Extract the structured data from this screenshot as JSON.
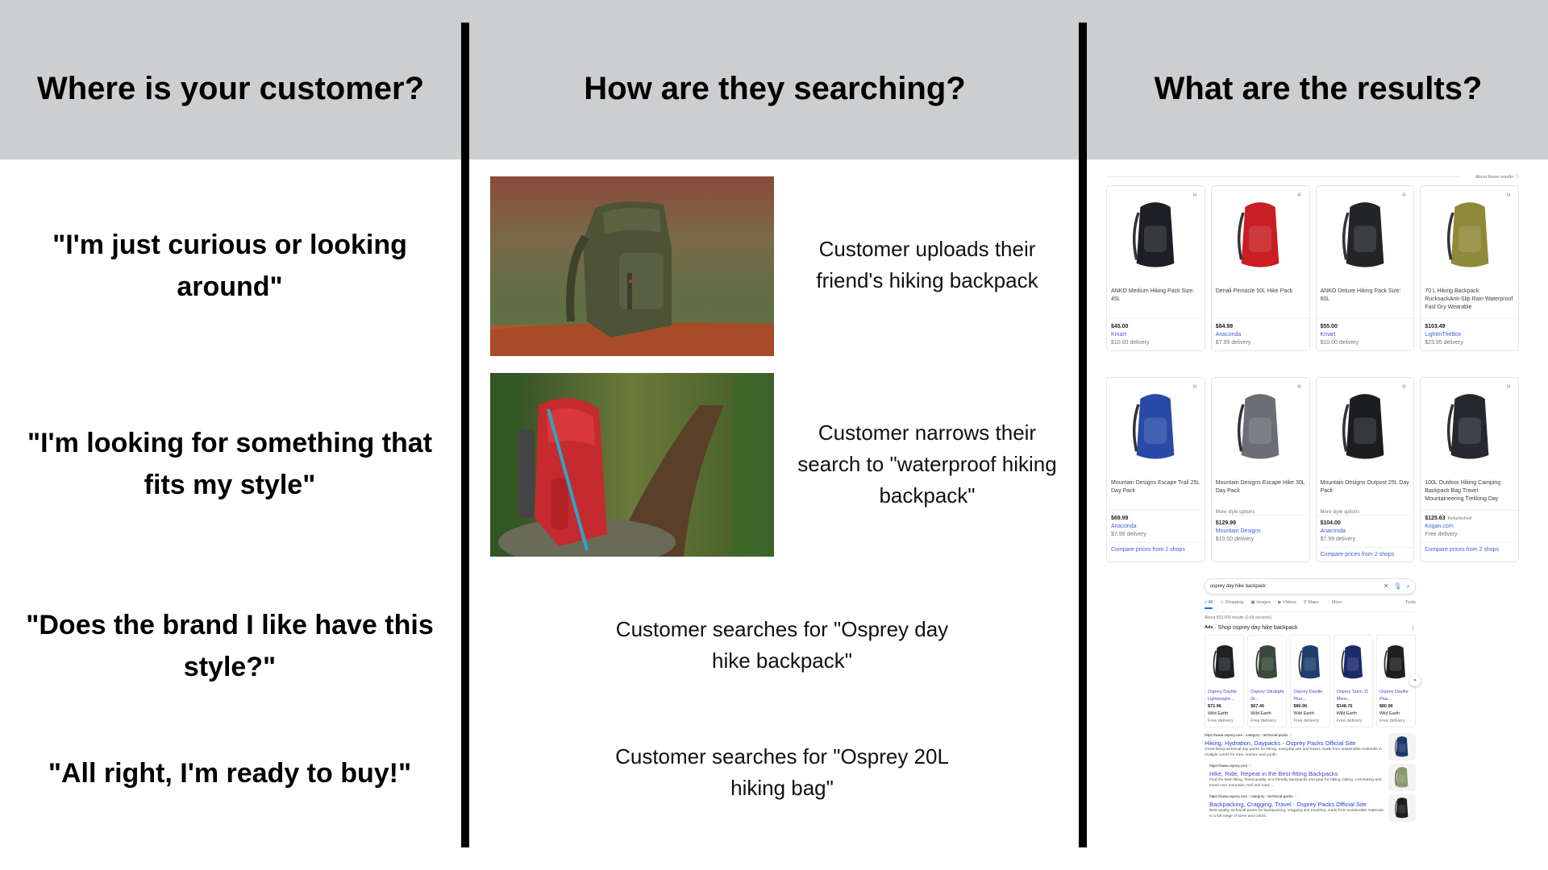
{
  "columns": [
    {
      "title": "Where is your customer?"
    },
    {
      "title": "How are they searching?"
    },
    {
      "title": "What are the results?"
    }
  ],
  "quotes": [
    "\"I'm just curious or looking around\"",
    "\"I'm looking for something that fits my style\"",
    "\"Does the brand I like have this style?\"",
    "\"All right, I'm ready to buy!\""
  ],
  "search_steps": [
    {
      "text": "Customer uploads their friend's hiking backpack",
      "image": "olive-backpack-on-red-rock-photo"
    },
    {
      "text": "Customer narrows their search to \"waterproof hiking backpack\"",
      "image": "red-backpack-in-forest-photo"
    },
    {
      "text": "Customer searches for \"Osprey day hike backpack\""
    },
    {
      "text": "Customer searches for \"Osprey 20L hiking bag\""
    }
  ],
  "results": {
    "about_label": "About these results ⓘ",
    "grid_row_1": [
      {
        "title": "ANKO Medium Hiking Pack Size: 45L",
        "price": "$45.00",
        "store": "Kmart",
        "delivery": "$10.00 delivery",
        "color": "#1d1f24"
      },
      {
        "title": "Denali Pinnacle 50L Hike Pack",
        "price": "$84.99",
        "store": "Anaconda",
        "delivery": "$7.99 delivery",
        "color": "#c81e24"
      },
      {
        "title": "ANKO Deluxe Hiking Pack Size: 60L",
        "price": "$55.00",
        "store": "Kmart",
        "delivery": "$10.00 delivery",
        "color": "#222428"
      },
      {
        "title": "70 L Hiking Backpack RucksackAnti-Slip Rain Waterproof Fast Dry Wearable",
        "price": "$103.49",
        "store": "LightInTheBox",
        "delivery": "$23.95 delivery",
        "color": "#8f8a3a"
      }
    ],
    "grid_row_2": [
      {
        "title": "Mountain Designs Escape Trail 25L Day Pack",
        "sub": "",
        "price": "$69.99",
        "store": "Anaconda",
        "delivery": "$7.99 delivery",
        "compare": "Compare prices from 2 shops",
        "color": "#2a4aa8"
      },
      {
        "title": "Mountain Designs Escape Hike 30L Day Pack",
        "sub": "More style options",
        "price": "$129.99",
        "store": "Mountain Designs",
        "delivery": "$10.00 delivery",
        "compare": "",
        "color": "#6b6e74"
      },
      {
        "title": "Mountain Designs Outpost 25L Day Pack",
        "sub": "More style options",
        "price": "$104.00",
        "store": "Anaconda",
        "delivery": "$7.99 delivery",
        "compare": "Compare prices from 2 shops",
        "color": "#1c1d20"
      },
      {
        "title": "100L Outdoor Hiking Camping Backpack Bag Travel Mountaineering Trekking Day",
        "sub": "",
        "price": "$125.63",
        "price_note": "Refurbished",
        "store": "Kogan.com",
        "delivery": "Free delivery",
        "compare": "Compare prices from 2 shops",
        "color": "#26282e"
      }
    ],
    "serp": {
      "query": "osprey day hike backpack",
      "tabs": [
        "All",
        "Shopping",
        "Images",
        "Videos",
        "Maps",
        "More"
      ],
      "tools_label": "Tools",
      "stats": "About 833,000 results (0.65 seconds)",
      "ads_label": "Ads",
      "ads_heading": "· Shop osprey day hike backpack",
      "ads": [
        {
          "name": "Osprey Daylite Lightweight...",
          "price": "$71.96",
          "store": "Wild Earth",
          "delivery": "Free delivery",
          "color": "#1f2022"
        },
        {
          "name": "Osprey Ultralight Dr...",
          "price": "$67.46",
          "store": "Wild Earth",
          "delivery": "Free delivery",
          "color": "#3a4a3a"
        },
        {
          "name": "Osprey Daylite Plus...",
          "price": "$80.96",
          "store": "Wild Earth",
          "delivery": "Free delivery",
          "color": "#1d3f6e"
        },
        {
          "name": "Osprey Talon 11 Mens...",
          "price": "$148.76",
          "store": "Wild Earth",
          "delivery": "Free delivery",
          "color": "#1c2a6a"
        },
        {
          "name": "Osprey Daylite Plus...",
          "price": "$80.96",
          "store": "Wild Earth",
          "delivery": "Free delivery",
          "color": "#1e1f21"
        }
      ],
      "organic": [
        {
          "url": "https://www.osprey.com › category › technical-packs  ⋮",
          "title": "Hiking, Hydration, Daypacks - Osprey Packs Official Site",
          "snippet": "Great-fitting technical day packs for hiking, everyday use and travel, made from sustainable materials in multiple colors for men, women and youth.",
          "color": "#1d3a6e"
        },
        {
          "url": "https://www.osprey.com  ⋮",
          "title": "Hike, Ride, Repeat in the Best-fitting Backpacks",
          "snippet": "Find the best-fitting, finest-quality, eco-friendly backpacks and gear for hiking, biking, commuting and travel over mountain, trail and road, ...",
          "color": "#8a9a6a"
        },
        {
          "url": "https://www.osprey.com › category › technical-packs  ⋮",
          "title": "Backpacking, Cragging, Travel - Osprey Packs Official Site",
          "snippet": "Best-quality technical packs for backpacking, cragging and traveling, made from sustainable materials in a full range of sizes and colors.",
          "color": "#1c1d1f"
        }
      ]
    }
  }
}
